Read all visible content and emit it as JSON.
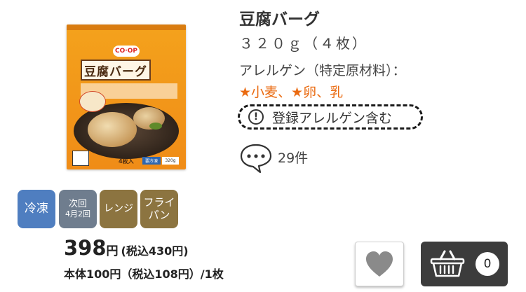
{
  "product": {
    "name": "豆腐バーグ",
    "size": "３２０ｇ（４枚）",
    "image": {
      "brand_logo": "CO·OP",
      "package_title": "豆腐バーグ",
      "count_label": "4枚入",
      "storage_label": "要冷凍",
      "weight_label": "320g"
    }
  },
  "allergen": {
    "label": "アレルゲン（特定原材料）：",
    "items": "★小麦、★卵、乳",
    "registered_text": "登録アレルゲン含む",
    "registered_icon": "exclamation-circle-icon"
  },
  "comments": {
    "icon": "speech-bubble-icon",
    "count": "29件"
  },
  "tags": {
    "frozen": "冷凍",
    "next_line1": "次回",
    "next_line2": "4月2回",
    "range": "レンジ",
    "fry_line1": "フライ",
    "fry_line2": "パン"
  },
  "price": {
    "main": "398",
    "yen": "円",
    "tax": "(税込430円)",
    "unit": "本体100円（税込108円）/1枚"
  },
  "buttons": {
    "favorite_icon": "heart-icon",
    "cart_icon": "basket-icon",
    "cart_count": "0"
  },
  "colors": {
    "allergen_highlight": "#ea6a10",
    "tag_frozen": "#4f7ec0",
    "tag_next": "#6f7d8e",
    "tag_cooking": "#8c7440",
    "cart_button": "#3c3c3c",
    "heart": "#8a8a8a"
  }
}
